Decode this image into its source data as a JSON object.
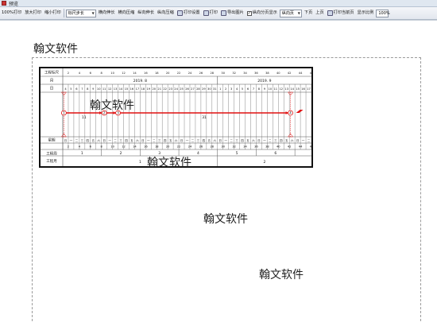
{
  "window": {
    "title": "预览"
  },
  "toolbar": {
    "actual_print": "100%打印",
    "zoom_in_print": "放大打印",
    "zoom_out_print": "缩小打印",
    "ruler_select": "标尺步长",
    "h_stretch": "横向伸长",
    "h_compress": "横向压缩",
    "v_stretch": "纵向伸长",
    "v_compress": "纵向压缩",
    "print_setup": "打印设置",
    "print": "打印",
    "export_image": "导出图片",
    "page_split_label": "纵向分页显示",
    "page_split_checked": "✓",
    "direction_select": "纵向页",
    "next_page": "下页",
    "prev_page": "上页",
    "print_current": "打印当前页",
    "zoom_label": "显示比例",
    "zoom_value": "100%"
  },
  "watermarks": [
    "翰文软件",
    "翰文软件",
    "翰文软件",
    "翰文软件",
    "翰文软件"
  ],
  "chart": {
    "row_labels": [
      "工程标尺",
      "月",
      "日",
      "星期",
      "工程周",
      "工程月"
    ],
    "month_labels": [
      "2019. 8",
      "2019. 9"
    ],
    "day_numbers": [
      "4",
      "5",
      "6",
      "7",
      "8",
      "9",
      "10",
      "11",
      "12",
      "13",
      "14",
      "15",
      "16",
      "17",
      "18",
      "19",
      "20",
      "21",
      "22",
      "23",
      "24",
      "25",
      "26",
      "27",
      "28",
      "29",
      "30",
      "31",
      "1",
      "2",
      "3",
      "4",
      "5",
      "6",
      "7",
      "8",
      "9",
      "10",
      "11",
      "12",
      "13",
      "14",
      "15",
      "16",
      "17"
    ],
    "scale_numbers": [
      "2",
      "4",
      "6",
      "8",
      "10",
      "12",
      "14",
      "16",
      "18",
      "20",
      "22",
      "24",
      "26",
      "28",
      "30",
      "32",
      "34",
      "36",
      "38",
      "40",
      "42",
      "44",
      "46"
    ],
    "week_numbers": [
      "1",
      "2",
      "3",
      "4",
      "5",
      "6",
      "7"
    ],
    "work_months": [
      "1",
      "2"
    ],
    "weekdays": [
      "日",
      "一",
      "二",
      "三",
      "四",
      "五",
      "六"
    ],
    "nodes": [
      "1",
      "2",
      "3",
      "4"
    ],
    "durations": [
      "11",
      "31"
    ],
    "task_color": "#e01010",
    "grid_color": "#555555"
  }
}
